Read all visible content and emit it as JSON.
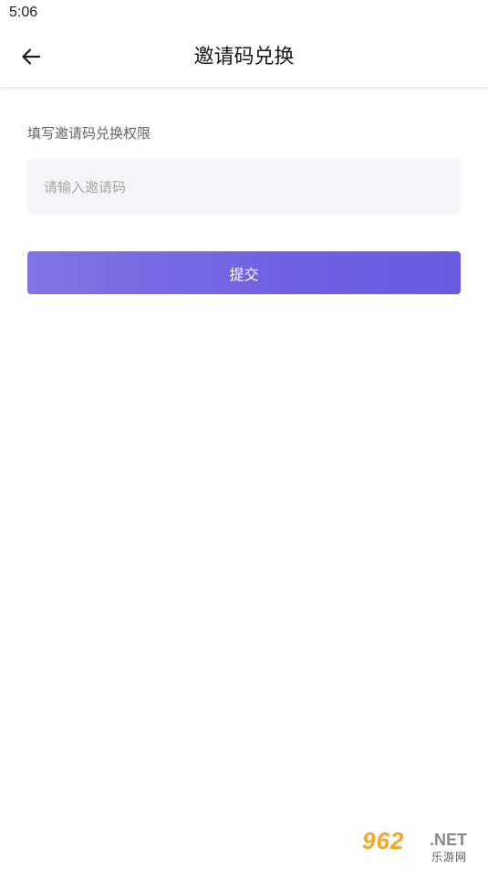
{
  "status_bar": {
    "time": "5:06"
  },
  "header": {
    "back_icon": "arrow-left-icon",
    "title": "邀请码兑换"
  },
  "form": {
    "label": "填写邀请码兑换权限",
    "code_input": {
      "value": "",
      "placeholder": "请输入邀请码"
    },
    "submit_label": "提交"
  },
  "watermark": {
    "main": "962",
    "net": ".NET",
    "sub": "乐游网"
  },
  "colors": {
    "accent_start": "#8074e6",
    "accent_end": "#6a5ce0",
    "input_bg": "#f5f6fa",
    "title_text": "#1a1a1a",
    "label_text": "#666666"
  }
}
